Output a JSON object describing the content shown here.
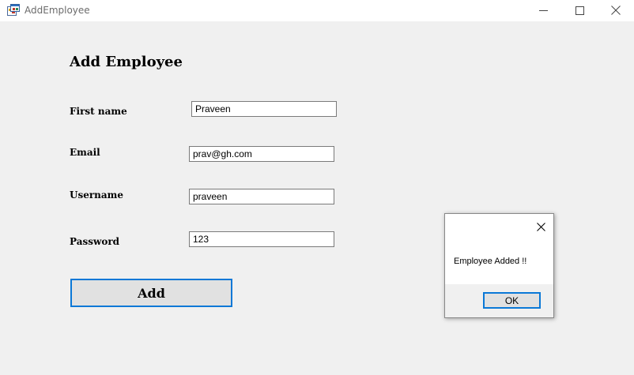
{
  "window": {
    "title": "AddEmployee",
    "icon": "app-form-icon",
    "controls": [
      "minimize-icon",
      "maximize-icon",
      "close-icon"
    ]
  },
  "form": {
    "heading": "Add Employee",
    "fields": [
      {
        "label": "First name",
        "value": "Praveen"
      },
      {
        "label": "Email",
        "value": "prav@gh.com"
      },
      {
        "label": "Username",
        "value": "praveen"
      },
      {
        "label": "Password",
        "value": "123"
      }
    ],
    "add_button": "Add"
  },
  "message_box": {
    "text": "Employee Added !!",
    "ok_label": "OK",
    "close_icon": "close-icon"
  },
  "colors": {
    "accent": "#0a78d7",
    "window_bg": "#f0f0f0",
    "titlebar_bg": "#ffffff"
  }
}
